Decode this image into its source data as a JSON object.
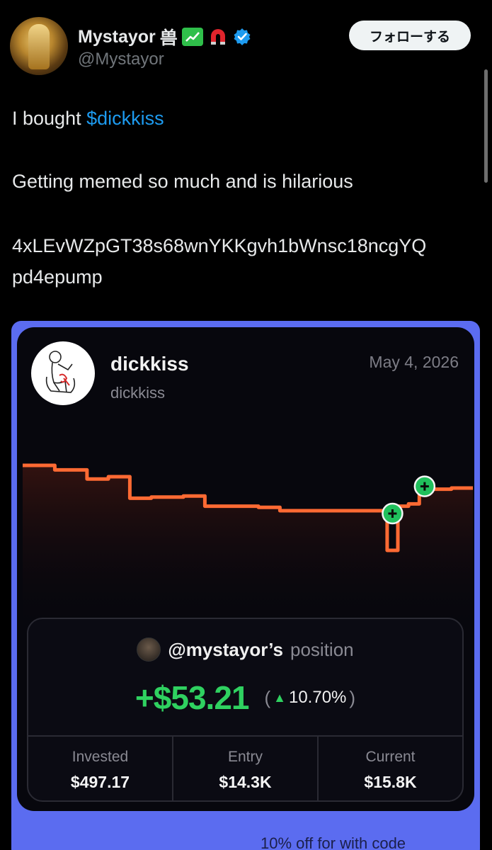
{
  "author": {
    "display_name": "Mystayor",
    "name_glyph": "兽",
    "handle": "@Mystayor",
    "verified": true,
    "avatar_icon": "golden-statue-avatar",
    "badges": [
      "chart-increasing-emoji",
      "magnet-emoji"
    ]
  },
  "follow_button": {
    "label": "フォローする"
  },
  "tweet": {
    "line1_prefix": "I bought ",
    "cashtag": "$dickkiss",
    "line2": "Getting memed so much and is hilarious",
    "address_line1": "4xLEvWZpGT38s68wnYKKgvh1bWnsc18ncgYQ",
    "address_line2": "pd4epump"
  },
  "card": {
    "token_name": "dickkiss",
    "token_symbol": "dickkiss",
    "date": "May 4, 2026",
    "position": {
      "user": "@mystayor’s",
      "label": "position",
      "pnl": "+$53.21",
      "pct_open": "(",
      "pct": "10.70%",
      "pct_close": ")",
      "stats": [
        {
          "label": "Invested",
          "value": "$497.17"
        },
        {
          "label": "Entry",
          "value": "$14.3K"
        },
        {
          "label": "Current",
          "value": "$15.8K"
        }
      ]
    },
    "footer_partial": "10% off for with code"
  },
  "colors": {
    "background": "#000000",
    "cashtag": "#1d9bf0",
    "card_border": "#5b6cf0",
    "chart_line": "#ff6a33",
    "profit": "#2fd160",
    "buy_marker": "#20c05c"
  },
  "chart_data": {
    "type": "line",
    "title": "",
    "xlabel": "",
    "ylabel": "",
    "series": [
      {
        "values": [
          100,
          100,
          100,
          96,
          96,
          96,
          88,
          88,
          90,
          90,
          71,
          71,
          72,
          72,
          72,
          73,
          73,
          64,
          64,
          64,
          64,
          64,
          63,
          63,
          60,
          60,
          60,
          60,
          60,
          60,
          60,
          60,
          60,
          60,
          25,
          64,
          66,
          79,
          79,
          79,
          80,
          80
        ]
      }
    ],
    "buy_markers": [
      {
        "index": 34
      },
      {
        "index": 37
      }
    ]
  }
}
